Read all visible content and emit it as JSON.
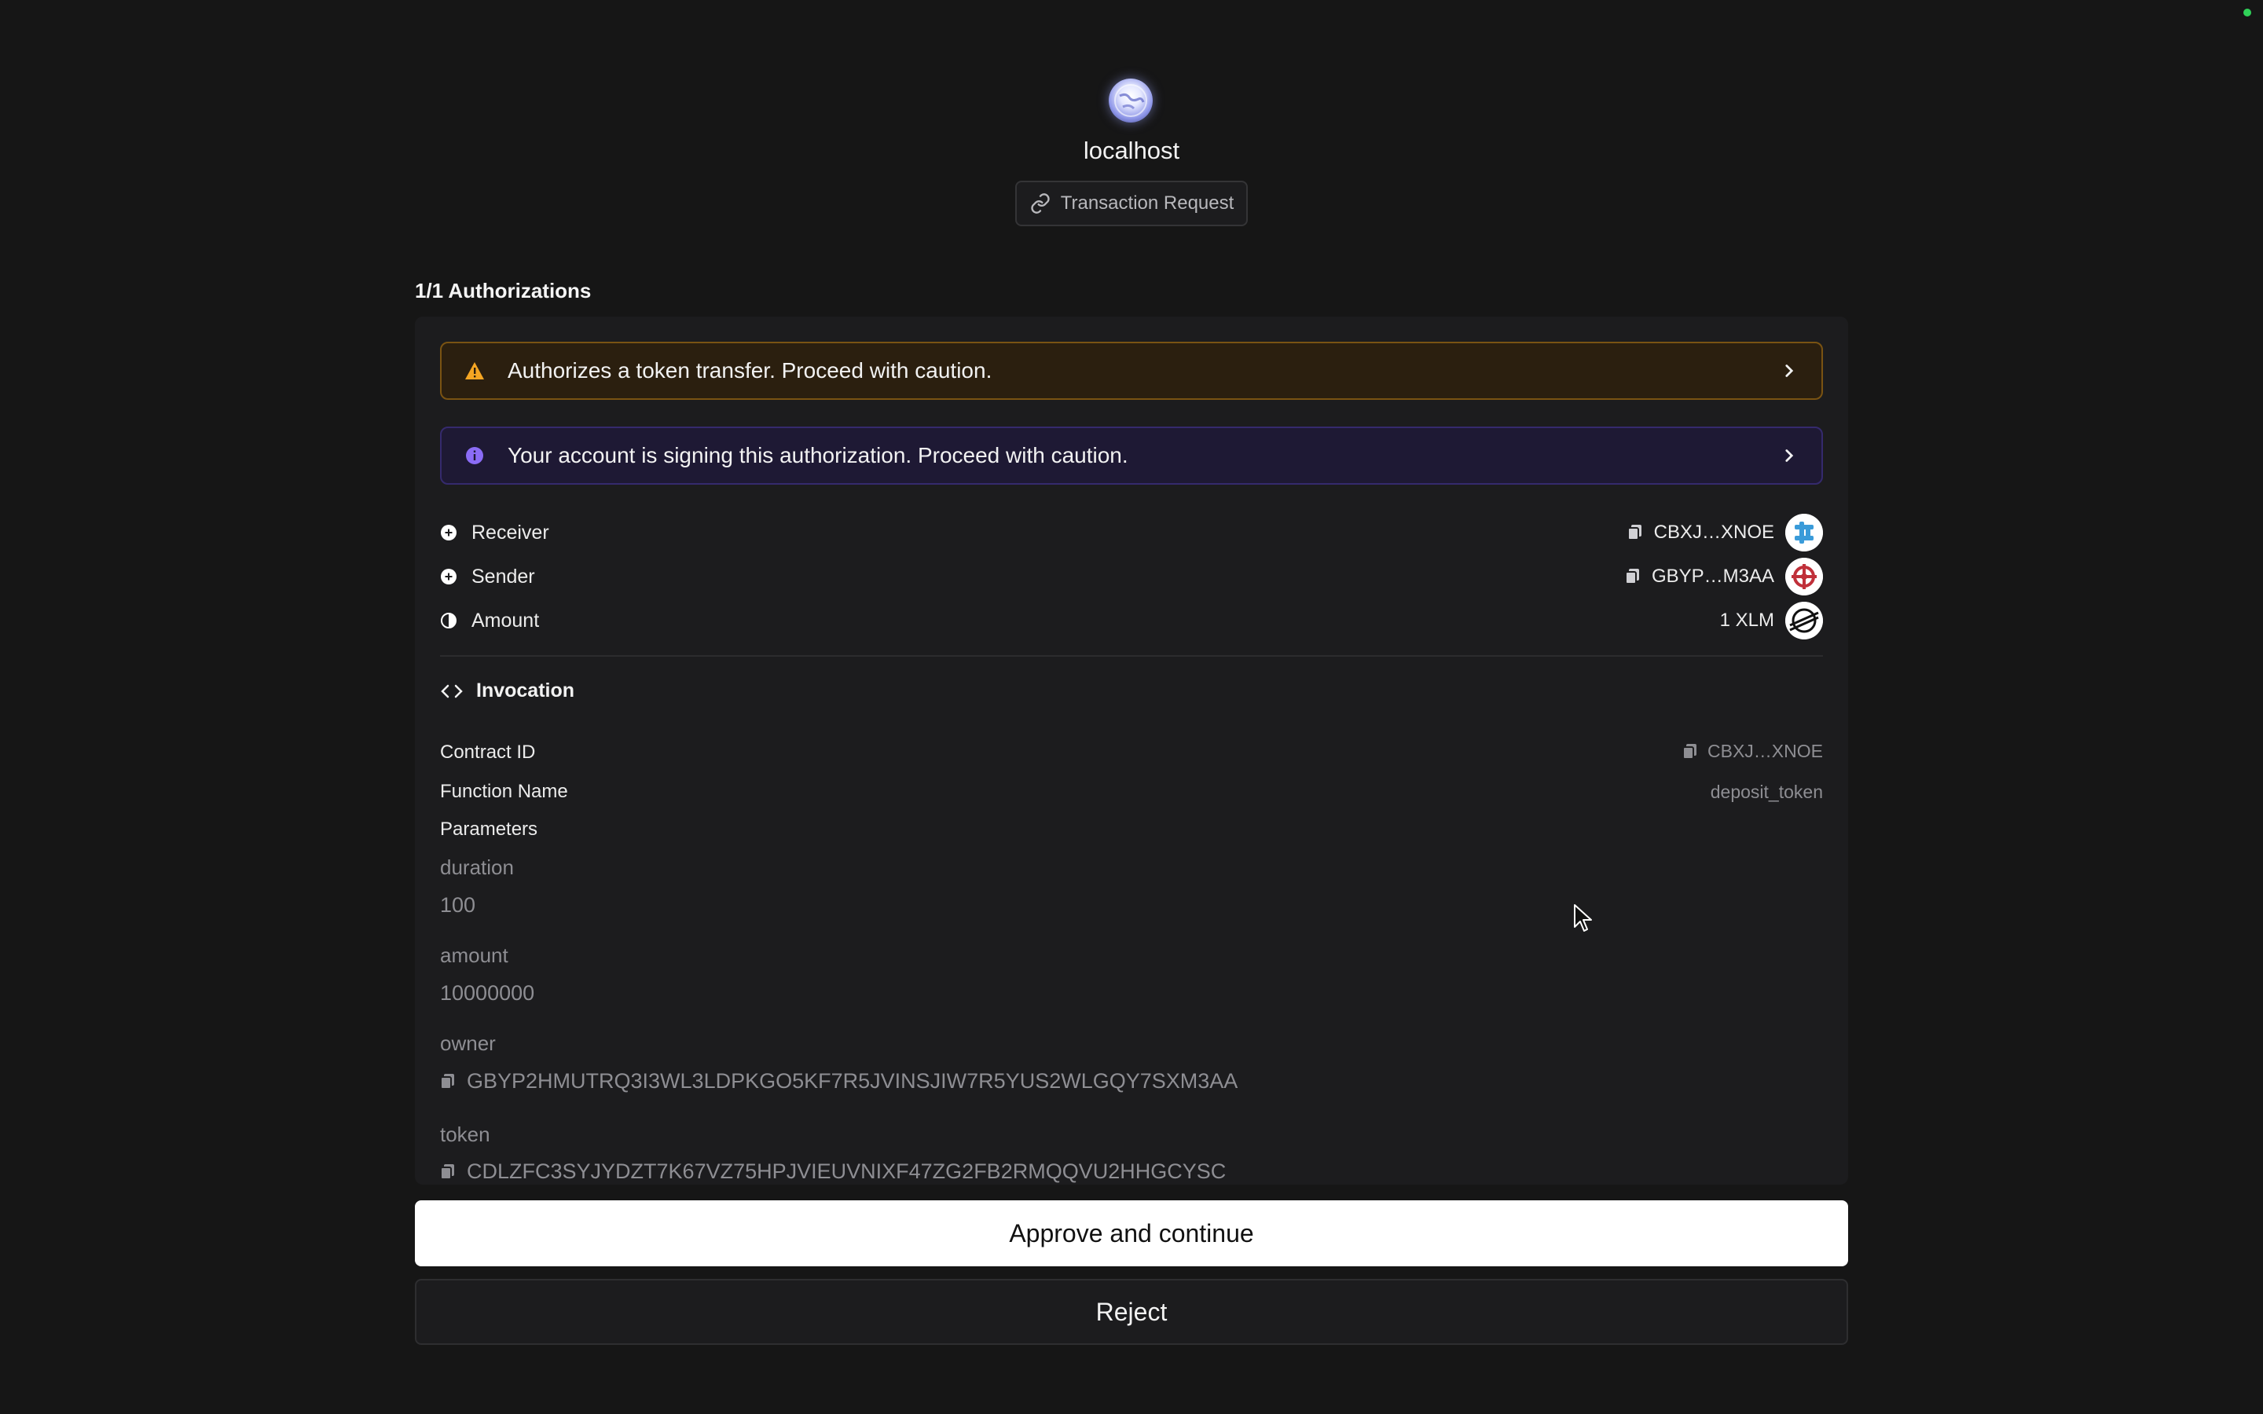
{
  "site": {
    "name": "localhost",
    "request_label": "Transaction Request",
    "icon": "globe-icon"
  },
  "authorizations": {
    "heading": "1/1 Authorizations"
  },
  "banners": {
    "warning": {
      "text": "Authorizes a token transfer. Proceed with caution.",
      "icon": "warning-icon",
      "color": "#f5a623"
    },
    "info": {
      "text": "Your account is signing this authorization. Proceed with caution.",
      "icon": "info-icon",
      "color": "#8b6cf6"
    }
  },
  "transfer": {
    "receiver": {
      "label": "Receiver",
      "value": "CBXJ…XNOE"
    },
    "sender": {
      "label": "Sender",
      "value": "GBYP…M3AA"
    },
    "amount": {
      "label": "Amount",
      "value": "1 XLM"
    }
  },
  "invocation": {
    "heading": "Invocation",
    "contract_id": {
      "label": "Contract ID",
      "value": "CBXJ…XNOE"
    },
    "function_name": {
      "label": "Function Name",
      "value": "deposit_token"
    },
    "parameters_label": "Parameters",
    "parameters": [
      {
        "name": "duration",
        "value": "100"
      },
      {
        "name": "amount",
        "value": "10000000"
      },
      {
        "name": "owner",
        "value": "GBYP2HMUTRQ3I3WL3LDPKGO5KF7R5JVINSJIW7R5YUS2WLGQY7SXM3AA"
      },
      {
        "name": "token",
        "value": "CDLZFC3SYJYDZT7K67VZ75HPJVIEUVNIXF47ZG2FB2RMQQVU2HHGCYSC"
      }
    ]
  },
  "actions": {
    "approve": "Approve and continue",
    "reject": "Reject"
  }
}
